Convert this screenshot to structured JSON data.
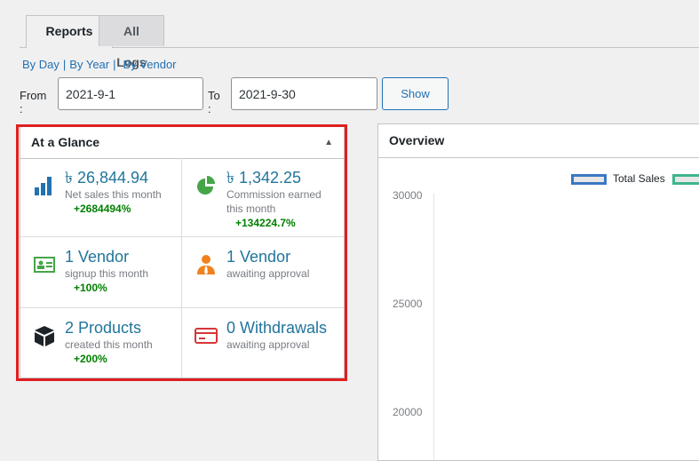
{
  "tabs": [
    {
      "label": "Reports",
      "active": true
    },
    {
      "label": "All Logs",
      "active": false
    }
  ],
  "subnav": {
    "by_day": "By Day",
    "by_year": "By Year",
    "by_vendor": "By Vendor",
    "separator": "|"
  },
  "date_filter": {
    "from_label": "From :",
    "from_value": "2021-9-1",
    "to_label": "To :",
    "to_value": "2021-9-30",
    "show_label": "Show"
  },
  "glance": {
    "title": "At a Glance",
    "toggle_icon": "triangle-up-icon",
    "items": [
      {
        "icon": "bar-chart-icon",
        "color": "#2271b1",
        "value": "৳ 26,844.94",
        "sub": "Net sales this month",
        "pct": "+2684494%"
      },
      {
        "icon": "pie-chart-icon",
        "color": "#46a548",
        "value": "৳ 1,342.25",
        "sub": "Commission earned this month",
        "pct": "+134224.7%"
      },
      {
        "icon": "id-card-icon",
        "color": "#46a548",
        "value": "1 Vendor",
        "sub": "signup this month",
        "pct": "+100%"
      },
      {
        "icon": "user-tie-icon",
        "color": "#f0821e",
        "value": "1 Vendor",
        "sub": "awaiting approval",
        "pct": ""
      },
      {
        "icon": "box-icon",
        "color": "#1d2327",
        "value": "2 Products",
        "sub": "created this month",
        "pct": "+200%"
      },
      {
        "icon": "credit-card-icon",
        "color": "#d63638",
        "value": "0 Withdrawals",
        "sub": "awaiting approval",
        "pct": ""
      }
    ]
  },
  "overview": {
    "title": "Overview",
    "legend": [
      {
        "name": "Total Sales",
        "color": "#3a78c3"
      },
      {
        "name": "",
        "color": "#3fb58e"
      }
    ],
    "y_ticks": [
      "30000",
      "25000",
      "20000"
    ]
  }
}
